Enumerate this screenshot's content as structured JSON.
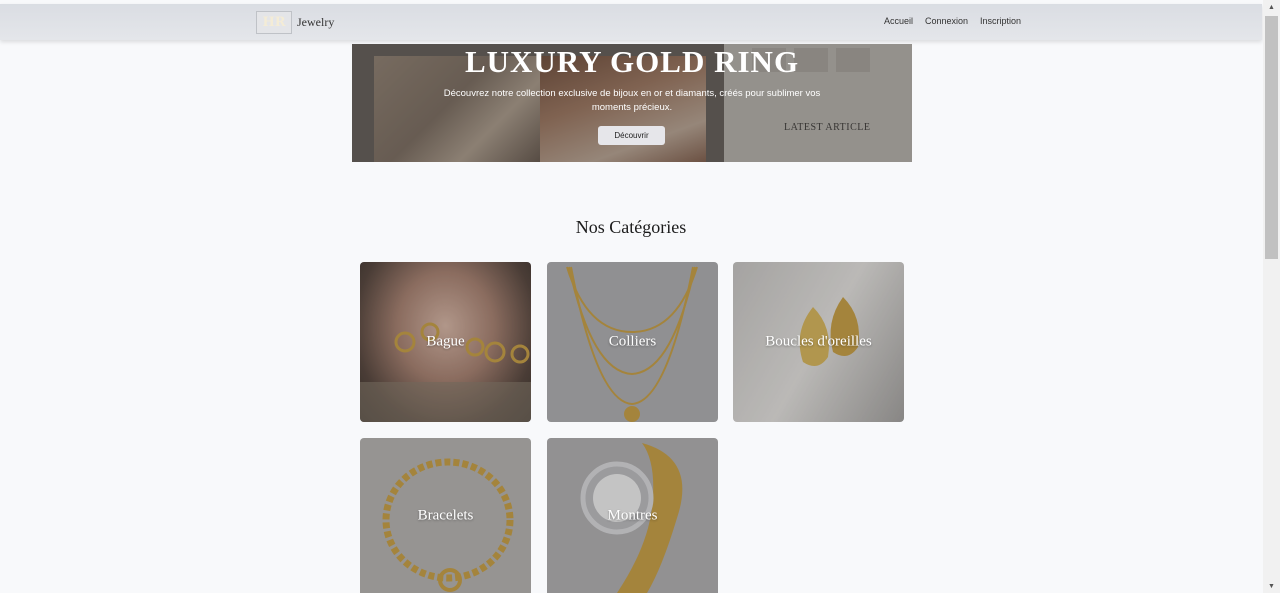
{
  "navbar": {
    "logo_text": "HR",
    "brand": "Jewelry",
    "links": [
      "Accueil",
      "Connexion",
      "Inscription"
    ]
  },
  "hero": {
    "title": "LUXURY GOLD RING",
    "subtitle": "Découvrez notre collection exclusive de bijoux en or et diamants, créés pour sublimer vos moments précieux.",
    "button": "Découvrir",
    "background_text": "LATEST ARTICLE"
  },
  "categories": {
    "title": "Nos Catégories",
    "items": [
      "Bague",
      "Colliers",
      "Boucles d'oreilles",
      "Bracelets",
      "Montres"
    ]
  },
  "colors": {
    "navbar": "#dadde3",
    "page_bg": "#f8f9fb",
    "gold": "#c9a24a"
  }
}
